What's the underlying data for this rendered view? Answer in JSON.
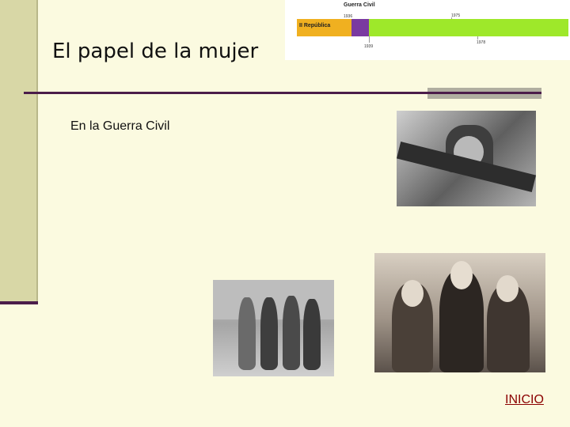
{
  "slide": {
    "title": "El papel de la mujer",
    "subtitle": "En la Guerra Civil",
    "nav_link": "INICIO"
  },
  "timeline": {
    "title": "Guerra Civil",
    "republic_label": "II República",
    "years": {
      "start_war": "1936",
      "end_war": "1939",
      "mid": "1975",
      "late": "1978"
    },
    "colors": {
      "republic": "#f0b020",
      "war": "#7a3aa0",
      "francoism": "#9ee82a"
    }
  },
  "colors": {
    "accent": "#4b1d4a",
    "background": "#fbfae0",
    "link": "#8b0000"
  }
}
